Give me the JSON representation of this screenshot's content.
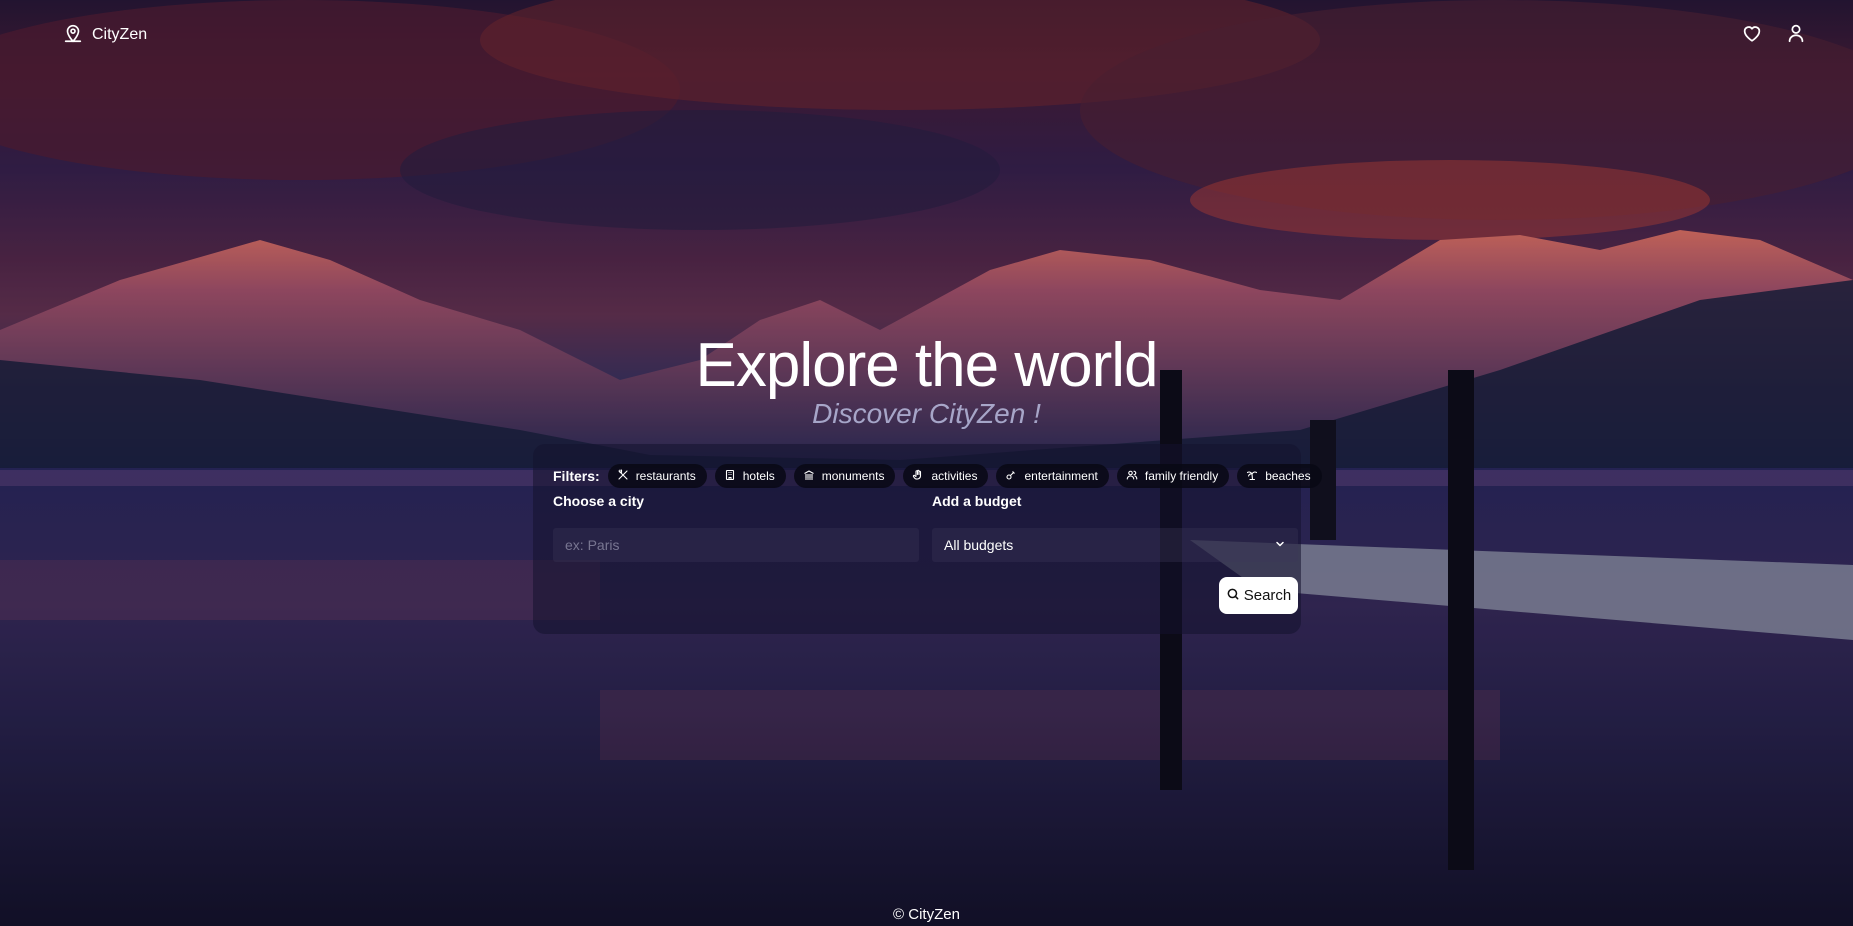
{
  "header": {
    "brand": "CityZen",
    "brand_icon": "map-pin-icon",
    "favorites_icon": "heart-icon",
    "account_icon": "user-icon"
  },
  "hero": {
    "title": "Explore the world",
    "subtitle": "Discover CityZen !"
  },
  "search": {
    "filters_label": "Filters:",
    "filters": [
      {
        "label": "restaurants",
        "icon": "utensils-icon"
      },
      {
        "label": "hotels",
        "icon": "building-icon"
      },
      {
        "label": "monuments",
        "icon": "landmark-icon"
      },
      {
        "label": "activities",
        "icon": "hand-icon"
      },
      {
        "label": "entertainment",
        "icon": "ticket-icon"
      },
      {
        "label": "family friendly",
        "icon": "users-icon"
      },
      {
        "label": "beaches",
        "icon": "palm-tree-icon"
      }
    ],
    "city_label": "Choose a city",
    "city_placeholder": "ex: Paris",
    "city_value": "",
    "budget_label": "Add a budget",
    "budget_value": "All budgets",
    "search_button": "Search"
  },
  "footer": {
    "copyright": "© CityZen"
  }
}
